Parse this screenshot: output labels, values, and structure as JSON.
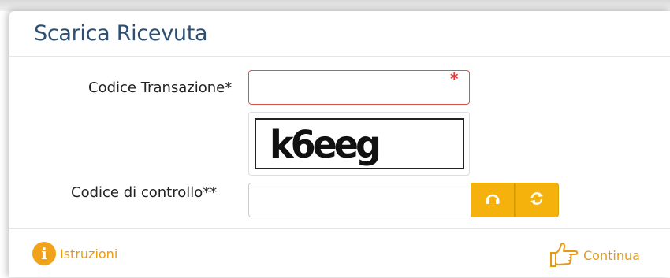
{
  "header": {
    "title": "Scarica Ricevuta"
  },
  "form": {
    "codice_label": "Codice Transazione*",
    "codice_value": "",
    "codice_required_mark": "*",
    "captcha_text": "k6eeg",
    "controllo_label": "Codice di controllo**",
    "controllo_value": ""
  },
  "footer": {
    "istruzioni_label": "Istruzioni",
    "continua_label": "Continua"
  },
  "colors": {
    "title": "#2c4f73",
    "accent": "#f5b20d",
    "link": "#e89a16",
    "required": "#e53935"
  },
  "icons": [
    "audio-icon",
    "refresh-icon",
    "info-icon",
    "hand-pointing-icon"
  ]
}
